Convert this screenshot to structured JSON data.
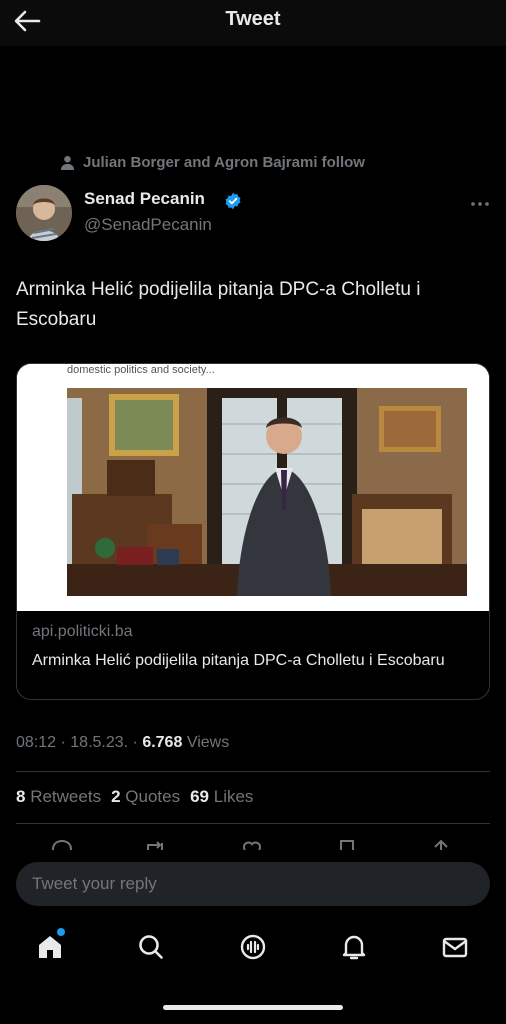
{
  "header": {
    "title": "Tweet"
  },
  "social_context": {
    "text": "Julian Borger and Agron Bajrami follow"
  },
  "author": {
    "name": "Senad Pecanin",
    "handle": "@SenadPecanin",
    "verified": true
  },
  "tweet": {
    "text": "Arminka Helić podijelila pitanja DPC-a Cholletu i Escobaru"
  },
  "card": {
    "image_caption": "domestic politics and society...",
    "domain": "api.politicki.ba",
    "title": "Arminka Helić podijelila pitanja DPC-a Cholletu i Escobaru"
  },
  "meta": {
    "time": "08:12",
    "date": "18.5.23.",
    "views_count": "6.768",
    "views_label": "Views"
  },
  "stats": {
    "retweets_count": "8",
    "retweets_label": "Retweets",
    "quotes_count": "2",
    "quotes_label": "Quotes",
    "likes_count": "69",
    "likes_label": "Likes"
  },
  "reply": {
    "placeholder": "Tweet your reply"
  },
  "nav": {
    "items": [
      "home-icon",
      "search-icon",
      "spaces-icon",
      "notifications-icon",
      "messages-icon"
    ]
  },
  "colors": {
    "accent": "#1d9bf0",
    "background": "#000000",
    "muted": "#71767b",
    "text": "#e7e9ea"
  }
}
